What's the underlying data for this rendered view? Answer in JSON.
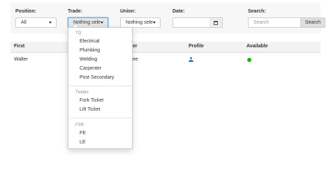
{
  "filters": {
    "position": {
      "label": "Position:",
      "value": "All"
    },
    "trade": {
      "label": "Trade:",
      "value": "Nothing sele"
    },
    "union": {
      "label": "Union:",
      "value": "Nothing sele"
    },
    "date": {
      "label": "Date:",
      "value": ""
    },
    "search": {
      "label": "Search:",
      "placeholder": "Search",
      "button_label": "Search"
    }
  },
  "table": {
    "columns": [
      "First",
      "er",
      "Profile",
      "Available"
    ],
    "rows": [
      {
        "first": "Walter",
        "col2": "ee",
        "profile_icon": "person-icon",
        "available": true
      }
    ]
  },
  "dropdown": {
    "groups": [
      {
        "name": "TQ",
        "options": [
          "Electrical",
          "Plumbing",
          "Welding",
          "Carpenter",
          "Post Secondary"
        ]
      },
      {
        "name": "Tickets",
        "options": [
          "Fork Ticket",
          "Lift Ticket"
        ]
      },
      {
        "name": "FSR",
        "options": [
          "FE",
          "LE"
        ]
      }
    ]
  },
  "colors": {
    "available": "#11b811",
    "profile_icon": "#337ab7",
    "focus_border": "#66afe9"
  },
  "icons": {
    "calendar": "calendar-icon",
    "caret": "chevron-down-icon",
    "profile": "person-icon"
  }
}
